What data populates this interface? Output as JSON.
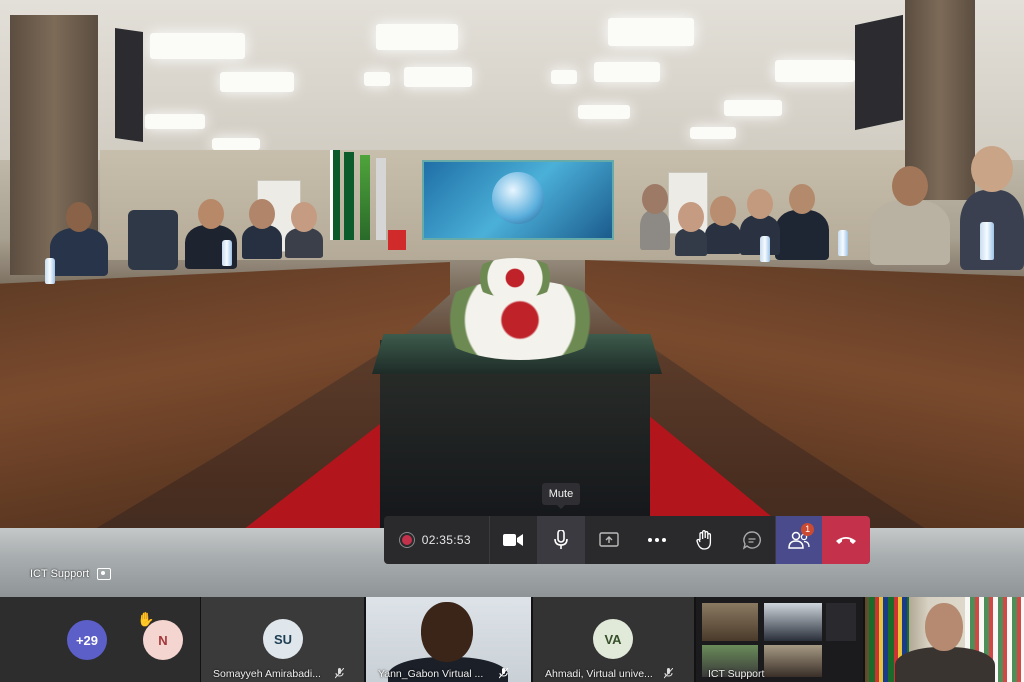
{
  "meeting": {
    "presenter_label": "ICT Support",
    "timer": "02:35:53",
    "tooltip": "Mute",
    "participants_badge": "1"
  },
  "controls": [
    {
      "name": "record-indicator",
      "icon": "record-dot-icon"
    },
    {
      "name": "camera-button",
      "icon": "video-camera-icon"
    },
    {
      "name": "mic-button",
      "icon": "microphone-icon"
    },
    {
      "name": "share-button",
      "icon": "share-screen-icon"
    },
    {
      "name": "more-button",
      "icon": "more-dots-icon"
    },
    {
      "name": "raise-hand-button",
      "icon": "hand-icon"
    },
    {
      "name": "chat-button",
      "icon": "chat-bubble-icon"
    },
    {
      "name": "participants-button",
      "icon": "people-icon"
    },
    {
      "name": "leave-button",
      "icon": "hang-up-icon"
    }
  ],
  "tiles": {
    "overflow": {
      "count": "+29",
      "color": "#5b5fc7"
    },
    "n": {
      "initials": "N",
      "color": "#f5d5d0",
      "text_color": "#a4373a",
      "hand": "✋"
    },
    "su": {
      "initials": "SU",
      "name": "Somayyeh Amirabadi...",
      "color": "#dfe7ec",
      "text_color": "#1e3e53"
    },
    "yann": {
      "name": "Yann_Gabon Virtual ..."
    },
    "va": {
      "initials": "VA",
      "name": "Ahmadi, Virtual unive...",
      "color": "#e1e9d9",
      "text_color": "#36502a"
    },
    "ict": {
      "name": "ICT Support"
    },
    "last": {}
  }
}
